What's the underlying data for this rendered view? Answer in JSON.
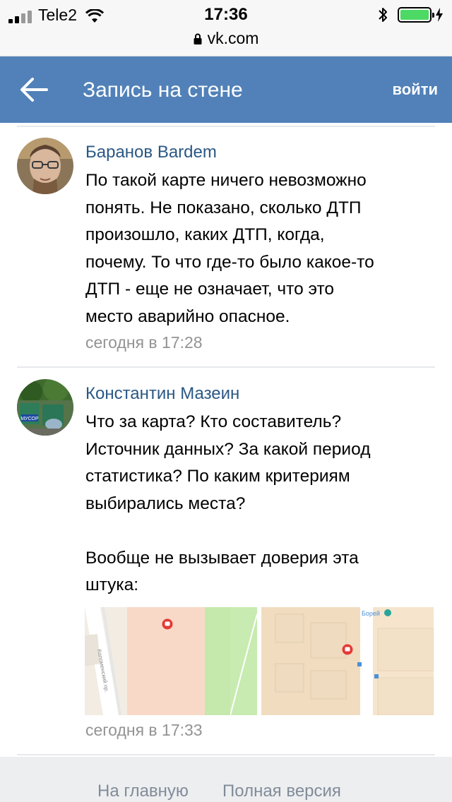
{
  "status_bar": {
    "carrier": "Tele2",
    "time": "17:36",
    "url": "vk.com",
    "signal_bars": 2,
    "battery_level": 1.0,
    "icons": [
      "signal-icon",
      "wifi-icon",
      "bluetooth-icon",
      "battery-icon",
      "charging-icon",
      "lock-icon"
    ]
  },
  "header": {
    "title": "Запись на стене",
    "login_label": "войти",
    "background_color": "#5181b8"
  },
  "comments": [
    {
      "author": "Баранов Bardem",
      "text": "По такой карте ничего невозможно\nпонять. Не показано, сколько ДТП\nпроизошло, каких ДТП, когда,\nпочему. То что где-то было какое-то\nДТП - еще не означает, что это\nместо аварийно опасное.",
      "date": "сегодня в 17:28"
    },
    {
      "author": "Константин Мазеин",
      "text": "Что за карта? Кто составитель?\nИсточник данных? За какой период\nстатистика? По каким критериям\nвыбирались места?\n\nВообще не вызывает доверия эта\nштука:",
      "date": "сегодня в 17:33",
      "avatar_label": "МУСОР",
      "attachment": {
        "map1_street": "Коломенский пр.",
        "map2_label": "Борей"
      }
    }
  ],
  "footer": {
    "home_label": "На главную",
    "full_version_label": "Полная версия"
  },
  "colors": {
    "link": "#2a5885",
    "muted": "#939393",
    "footer_bg": "#edeef0",
    "footer_text": "#818c99"
  }
}
